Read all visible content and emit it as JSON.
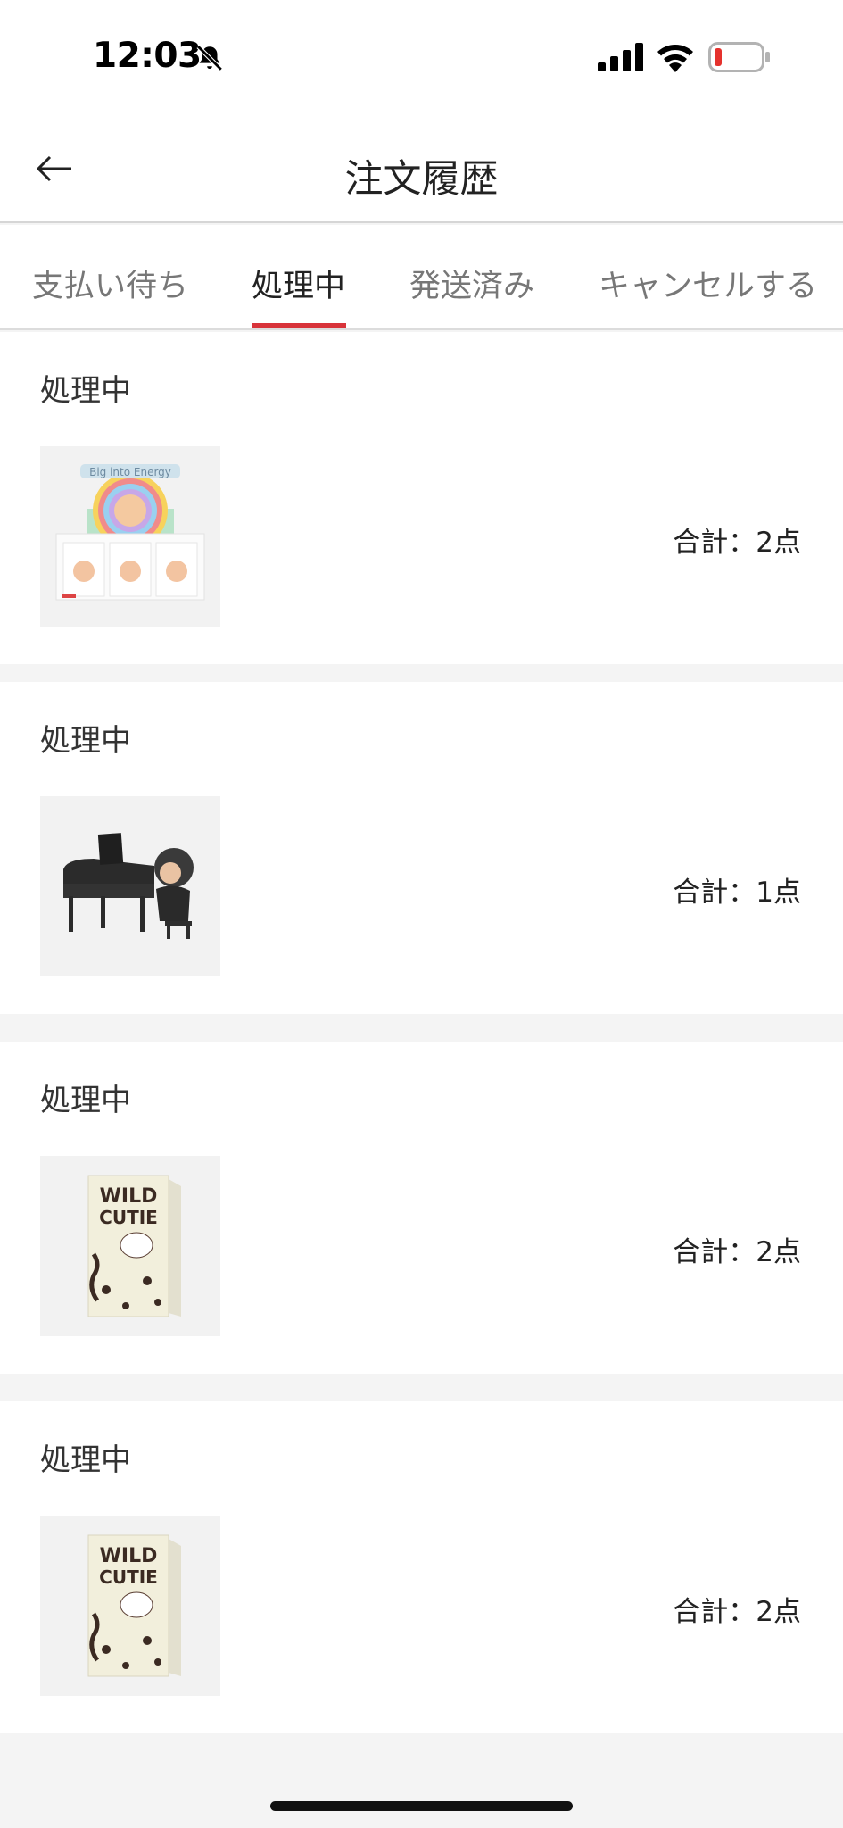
{
  "status_bar": {
    "time": "12:03"
  },
  "header": {
    "title": "注文履歴",
    "back_icon": "arrow-left-icon"
  },
  "tabs": [
    {
      "label": "支払い待ち",
      "active": false
    },
    {
      "label": "処理中",
      "active": true
    },
    {
      "label": "発送済み",
      "active": false
    },
    {
      "label": "キャンセルする",
      "active": false
    }
  ],
  "colors": {
    "accent": "#d8333a",
    "background": "#f4f4f4"
  },
  "orders": [
    {
      "status": "処理中",
      "image": "big-into-energy-box-set-image",
      "total": "合計：2点"
    },
    {
      "status": "処理中",
      "image": "piano-figure-image",
      "total": "合計：1点"
    },
    {
      "status": "処理中",
      "image": "wild-cutie-box-image",
      "total": "合計：2点"
    },
    {
      "status": "処理中",
      "image": "wild-cutie-box-image",
      "total": "合計：2点"
    }
  ]
}
